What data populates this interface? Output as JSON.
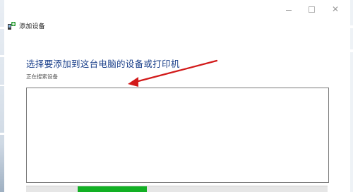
{
  "window": {
    "title": "添加设备",
    "icon": "add-device-icon",
    "controls": {
      "minimize": "minimize-icon",
      "maximize": "maximize-icon",
      "close": "close-icon",
      "close_glyph": "✕"
    }
  },
  "main": {
    "heading": "选择要添加到这台电脑的设备或打印机",
    "status": "正在搜索设备",
    "device_list": [],
    "progress": {
      "state": "indeterminate",
      "segment_start_fraction": 0.17,
      "segment_end_fraction": 0.4
    }
  },
  "annotation": {
    "type": "arrow",
    "color": "#d21a1a",
    "points_to": "正在搜索设备"
  },
  "colors": {
    "heading": "#1a3f8a",
    "progress": "#12b024",
    "arrow": "#d21a1a"
  }
}
